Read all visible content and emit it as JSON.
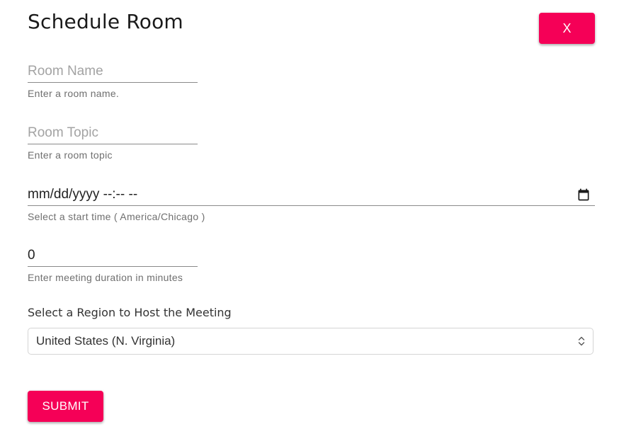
{
  "dialog": {
    "title": "Schedule Room",
    "close_label": "X"
  },
  "form": {
    "room_name": {
      "value": "",
      "placeholder": "Room Name",
      "helper": "Enter a room name."
    },
    "room_topic": {
      "value": "",
      "placeholder": "Room Topic",
      "helper": "Enter a room topic"
    },
    "start_time": {
      "display": "mm/dd/yyyy --:-- --",
      "helper": "Select a start time ( America/Chicago )",
      "icon": "calendar-icon"
    },
    "duration": {
      "value": "0",
      "helper": "Enter meeting duration in minutes"
    },
    "region": {
      "label": "Select a Region to Host the Meeting",
      "selected": "United States (N. Virginia)",
      "icon": "chevron-up-down-icon"
    },
    "submit_label": "SUBMIT"
  },
  "colors": {
    "accent": "#f50057",
    "underline": "#8a8a8a",
    "helper_text": "#6f6f6f",
    "placeholder": "#a3a3a3"
  }
}
